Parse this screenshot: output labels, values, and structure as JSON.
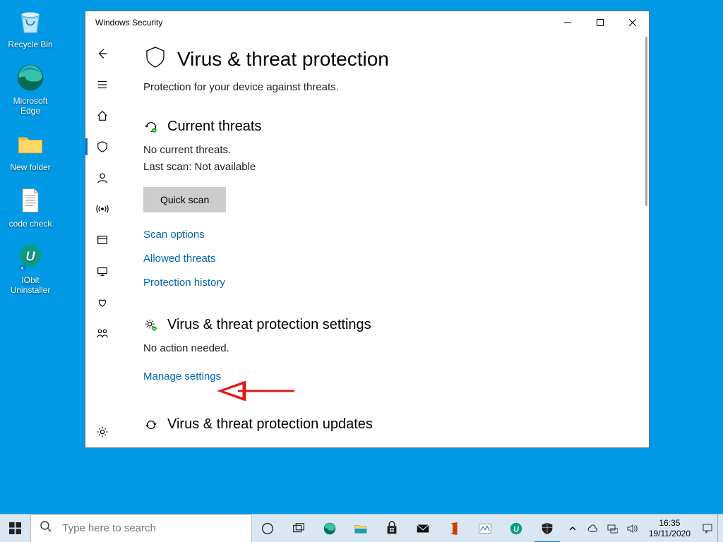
{
  "desktop": {
    "items": [
      {
        "label": "Recycle Bin"
      },
      {
        "label": "Microsoft Edge"
      },
      {
        "label": "New folder"
      },
      {
        "label": "code check"
      },
      {
        "label": "IObit Uninstaller"
      }
    ]
  },
  "window": {
    "app_title": "Windows Security",
    "page_title": "Virus & threat protection",
    "page_subtitle": "Protection for your device against threats.",
    "current_threats": {
      "title": "Current threats",
      "status1": "No current threats.",
      "status2": "Last scan: Not available",
      "button": "Quick scan",
      "links": [
        "Scan options",
        "Allowed threats",
        "Protection history"
      ]
    },
    "settings": {
      "title": "Virus & threat protection settings",
      "status": "No action needed.",
      "link": "Manage settings"
    },
    "updates": {
      "title": "Virus & threat protection updates"
    }
  },
  "taskbar": {
    "search_placeholder": "Type here to search",
    "time": "16:35",
    "date": "19/11/2020"
  }
}
